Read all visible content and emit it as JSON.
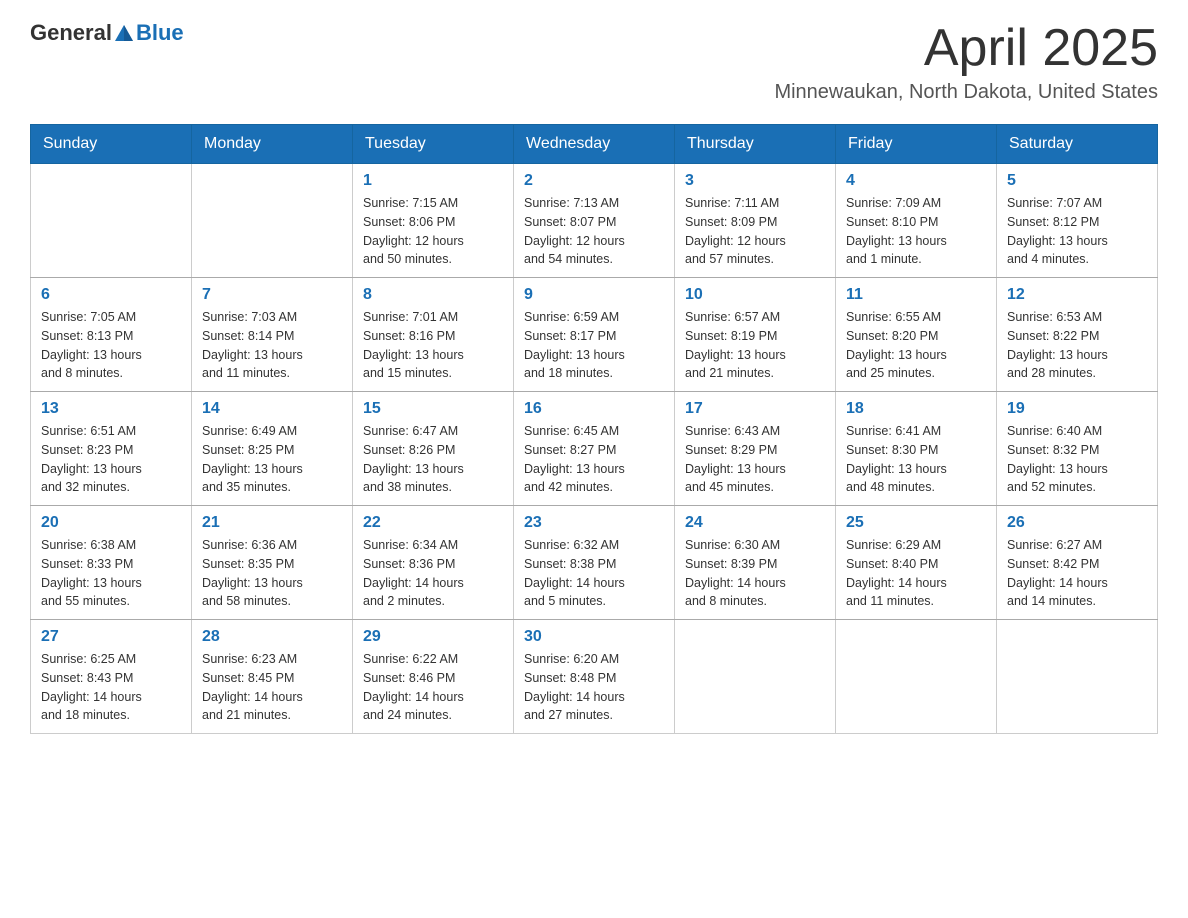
{
  "header": {
    "logo_general": "General",
    "logo_blue": "Blue",
    "month_title": "April 2025",
    "location": "Minnewaukan, North Dakota, United States"
  },
  "days_of_week": [
    "Sunday",
    "Monday",
    "Tuesday",
    "Wednesday",
    "Thursday",
    "Friday",
    "Saturday"
  ],
  "weeks": [
    [
      {
        "day": "",
        "info": ""
      },
      {
        "day": "",
        "info": ""
      },
      {
        "day": "1",
        "info": "Sunrise: 7:15 AM\nSunset: 8:06 PM\nDaylight: 12 hours\nand 50 minutes."
      },
      {
        "day": "2",
        "info": "Sunrise: 7:13 AM\nSunset: 8:07 PM\nDaylight: 12 hours\nand 54 minutes."
      },
      {
        "day": "3",
        "info": "Sunrise: 7:11 AM\nSunset: 8:09 PM\nDaylight: 12 hours\nand 57 minutes."
      },
      {
        "day": "4",
        "info": "Sunrise: 7:09 AM\nSunset: 8:10 PM\nDaylight: 13 hours\nand 1 minute."
      },
      {
        "day": "5",
        "info": "Sunrise: 7:07 AM\nSunset: 8:12 PM\nDaylight: 13 hours\nand 4 minutes."
      }
    ],
    [
      {
        "day": "6",
        "info": "Sunrise: 7:05 AM\nSunset: 8:13 PM\nDaylight: 13 hours\nand 8 minutes."
      },
      {
        "day": "7",
        "info": "Sunrise: 7:03 AM\nSunset: 8:14 PM\nDaylight: 13 hours\nand 11 minutes."
      },
      {
        "day": "8",
        "info": "Sunrise: 7:01 AM\nSunset: 8:16 PM\nDaylight: 13 hours\nand 15 minutes."
      },
      {
        "day": "9",
        "info": "Sunrise: 6:59 AM\nSunset: 8:17 PM\nDaylight: 13 hours\nand 18 minutes."
      },
      {
        "day": "10",
        "info": "Sunrise: 6:57 AM\nSunset: 8:19 PM\nDaylight: 13 hours\nand 21 minutes."
      },
      {
        "day": "11",
        "info": "Sunrise: 6:55 AM\nSunset: 8:20 PM\nDaylight: 13 hours\nand 25 minutes."
      },
      {
        "day": "12",
        "info": "Sunrise: 6:53 AM\nSunset: 8:22 PM\nDaylight: 13 hours\nand 28 minutes."
      }
    ],
    [
      {
        "day": "13",
        "info": "Sunrise: 6:51 AM\nSunset: 8:23 PM\nDaylight: 13 hours\nand 32 minutes."
      },
      {
        "day": "14",
        "info": "Sunrise: 6:49 AM\nSunset: 8:25 PM\nDaylight: 13 hours\nand 35 minutes."
      },
      {
        "day": "15",
        "info": "Sunrise: 6:47 AM\nSunset: 8:26 PM\nDaylight: 13 hours\nand 38 minutes."
      },
      {
        "day": "16",
        "info": "Sunrise: 6:45 AM\nSunset: 8:27 PM\nDaylight: 13 hours\nand 42 minutes."
      },
      {
        "day": "17",
        "info": "Sunrise: 6:43 AM\nSunset: 8:29 PM\nDaylight: 13 hours\nand 45 minutes."
      },
      {
        "day": "18",
        "info": "Sunrise: 6:41 AM\nSunset: 8:30 PM\nDaylight: 13 hours\nand 48 minutes."
      },
      {
        "day": "19",
        "info": "Sunrise: 6:40 AM\nSunset: 8:32 PM\nDaylight: 13 hours\nand 52 minutes."
      }
    ],
    [
      {
        "day": "20",
        "info": "Sunrise: 6:38 AM\nSunset: 8:33 PM\nDaylight: 13 hours\nand 55 minutes."
      },
      {
        "day": "21",
        "info": "Sunrise: 6:36 AM\nSunset: 8:35 PM\nDaylight: 13 hours\nand 58 minutes."
      },
      {
        "day": "22",
        "info": "Sunrise: 6:34 AM\nSunset: 8:36 PM\nDaylight: 14 hours\nand 2 minutes."
      },
      {
        "day": "23",
        "info": "Sunrise: 6:32 AM\nSunset: 8:38 PM\nDaylight: 14 hours\nand 5 minutes."
      },
      {
        "day": "24",
        "info": "Sunrise: 6:30 AM\nSunset: 8:39 PM\nDaylight: 14 hours\nand 8 minutes."
      },
      {
        "day": "25",
        "info": "Sunrise: 6:29 AM\nSunset: 8:40 PM\nDaylight: 14 hours\nand 11 minutes."
      },
      {
        "day": "26",
        "info": "Sunrise: 6:27 AM\nSunset: 8:42 PM\nDaylight: 14 hours\nand 14 minutes."
      }
    ],
    [
      {
        "day": "27",
        "info": "Sunrise: 6:25 AM\nSunset: 8:43 PM\nDaylight: 14 hours\nand 18 minutes."
      },
      {
        "day": "28",
        "info": "Sunrise: 6:23 AM\nSunset: 8:45 PM\nDaylight: 14 hours\nand 21 minutes."
      },
      {
        "day": "29",
        "info": "Sunrise: 6:22 AM\nSunset: 8:46 PM\nDaylight: 14 hours\nand 24 minutes."
      },
      {
        "day": "30",
        "info": "Sunrise: 6:20 AM\nSunset: 8:48 PM\nDaylight: 14 hours\nand 27 minutes."
      },
      {
        "day": "",
        "info": ""
      },
      {
        "day": "",
        "info": ""
      },
      {
        "day": "",
        "info": ""
      }
    ]
  ]
}
